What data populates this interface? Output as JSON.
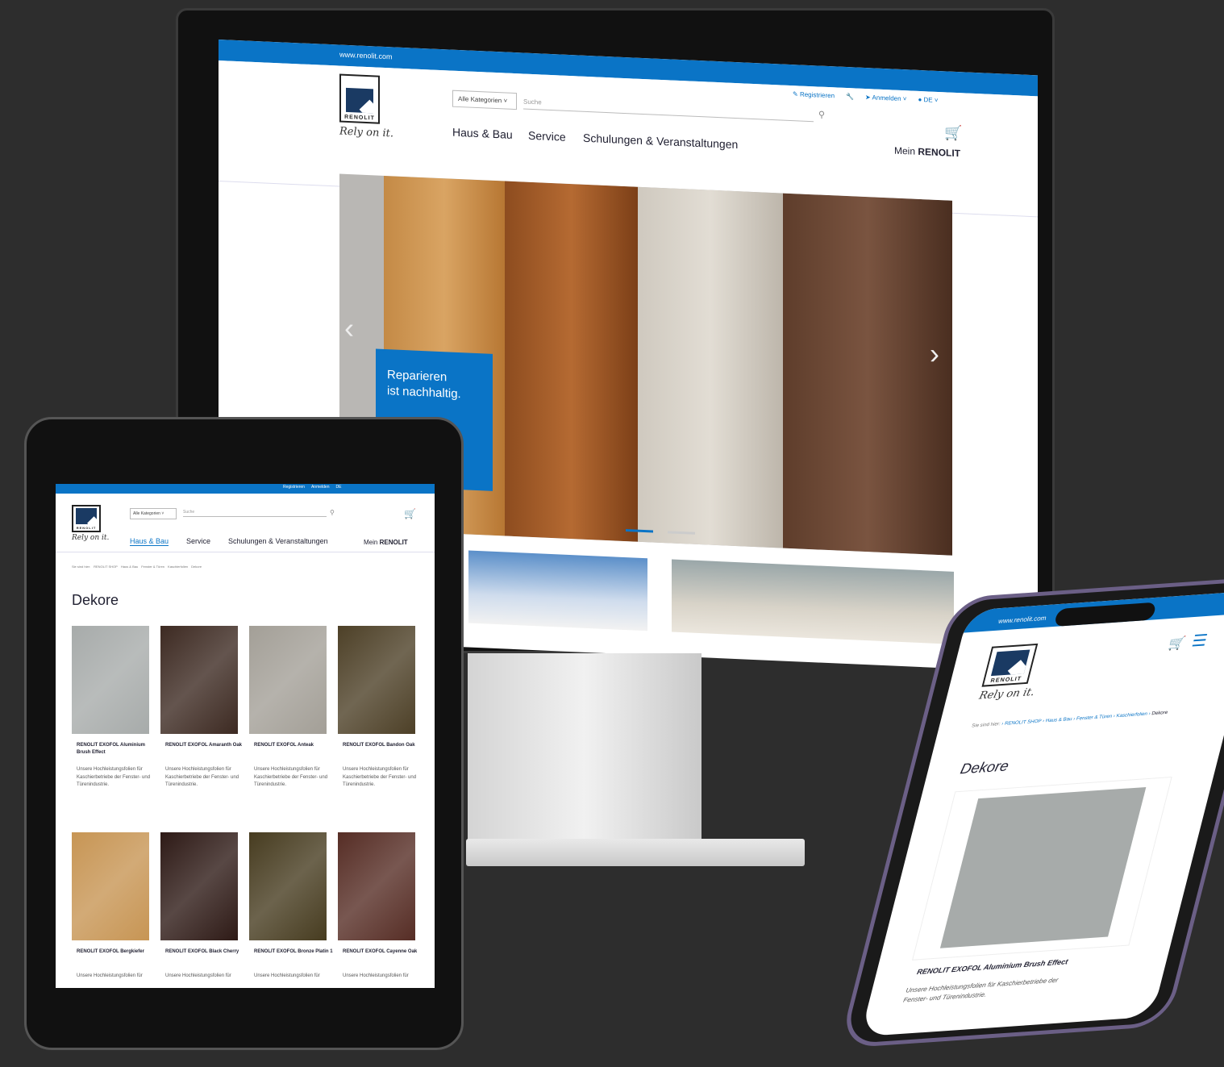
{
  "brand": {
    "logo_text": "RENOLIT",
    "slogan": "Rely on it.",
    "url": "www.renolit.com",
    "colors": {
      "primary": "#0a74c6",
      "navy": "#1a3a63",
      "dark_bg": "#2d2d2d"
    }
  },
  "topbar": {
    "register": "Registrieren",
    "login": "Anmelden",
    "language": "DE"
  },
  "search": {
    "category_select": "Alle Kategorien",
    "placeholder": "Suche"
  },
  "nav": {
    "items": [
      "Haus & Bau",
      "Service",
      "Schulungen & Veranstaltungen"
    ],
    "account_prefix": "Mein",
    "account_brand": "RENOLIT"
  },
  "hero": {
    "line1": "Reparieren",
    "line2": "ist nachhaltig.",
    "prev_icon": "chevron-left-icon",
    "next_icon": "chevron-right-icon"
  },
  "breadcrumb": {
    "label": "Sie sind hier:",
    "items": [
      "RENOLIT SHOP",
      "Haus & Bau",
      "Fenster & Türen",
      "Kaschierfolien",
      "Dekore"
    ]
  },
  "page_title": "Dekore",
  "products": [
    {
      "name": "RENOLIT EXOFOL Aluminium Brush Effect",
      "desc": "Unsere Hochleistungsfolien für Kaschierbetriebe der Fenster- und Türenindustrie.",
      "color": "#a7abaa"
    },
    {
      "name": "RENOLIT EXOFOL Amaranth Oak",
      "desc": "Unsere Hochleistungsfolien für Kaschierbetriebe der Fenster- und Türenindustrie.",
      "color": "#3d2a22"
    },
    {
      "name": "RENOLIT EXOFOL Anteak",
      "desc": "Unsere Hochleistungsfolien für Kaschierbetriebe der Fenster- und Türenindustrie.",
      "color": "#a39f97"
    },
    {
      "name": "RENOLIT EXOFOL Bandon Oak",
      "desc": "Unsere Hochleistungsfolien für Kaschierbetriebe der Fenster- und Türenindustrie.",
      "color": "#4d4027"
    },
    {
      "name": "RENOLIT EXOFOL Bergkiefer",
      "desc": "Unsere Hochleistungsfolien für",
      "color": "#c79554"
    },
    {
      "name": "RENOLIT EXOFOL Black Cherry",
      "desc": "Unsere Hochleistungsfolien für",
      "color": "#2e1a16"
    },
    {
      "name": "RENOLIT EXOFOL Bronze Platin 1",
      "desc": "Unsere Hochleistungsfolien für",
      "color": "#473c20"
    },
    {
      "name": "RENOLIT EXOFOL Cayenne Oak",
      "desc": "Unsere Hochleistungsfolien für",
      "color": "#562d25"
    }
  ],
  "phone_product": {
    "name": "RENOLIT EXOFOL Aluminium Brush Effect",
    "desc": "Unsere Hochleistungsfolien für Kaschierbetriebe der Fenster- und Türenindustrie."
  }
}
